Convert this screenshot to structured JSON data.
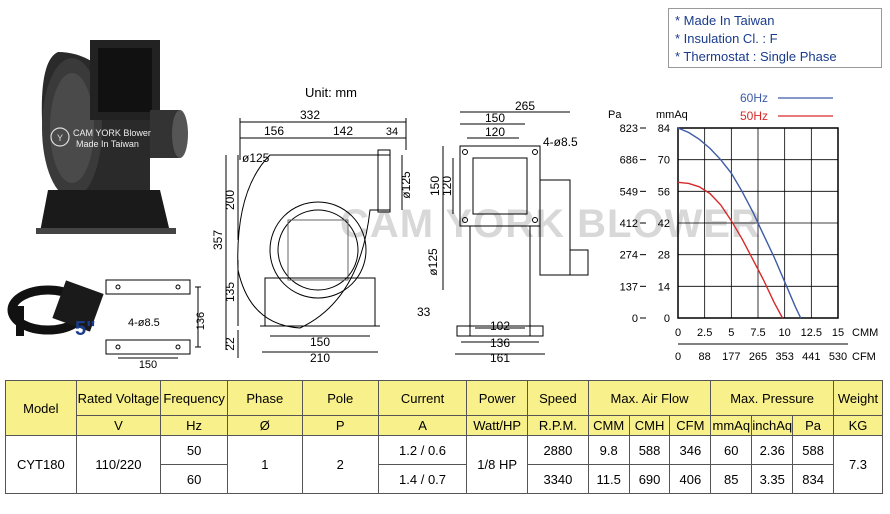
{
  "notes": [
    "* Made In Taiwan",
    "* Insulation Cl. : F",
    "* Thermostat : Single Phase"
  ],
  "unit_label": "Unit: mm",
  "watermark": "CAM YORK BLOWER",
  "photo": {
    "brand_line1": "CAM YORK Blower",
    "brand_line2": "Made In Taiwan"
  },
  "flange": {
    "size_label": "5\"",
    "hole_label": "4-ø8.5",
    "dim_w": "150",
    "dim_h": "136"
  },
  "side_view": {
    "d_332": "332",
    "d_156": "156",
    "d_142": "142",
    "d_34": "34",
    "d_125_top": "ø125",
    "d_125_side": "ø125",
    "d_200": "200",
    "d_357": "357",
    "d_135": "135",
    "d_22": "22",
    "d_150": "150",
    "d_210": "210"
  },
  "front_view": {
    "d_265": "265",
    "d_150": "150",
    "d_120": "120",
    "holes": "4-ø8.5",
    "d_150v": "150",
    "d_120v": "120",
    "d_125": "ø125",
    "d_33": "33",
    "d_102": "102",
    "d_136": "136",
    "d_161": "161"
  },
  "colors": {
    "hz60": "#3d5ba8",
    "hz50": "#d62a2a",
    "header_bg": "#f8f08a",
    "note_text": "#1a3c8c"
  },
  "chart_data": {
    "type": "line",
    "legend_placement": "top-right",
    "y_unit_left": "Pa",
    "y_unit_right": "mmAq",
    "y_ticks_pa": [
      "823",
      "686",
      "549",
      "412",
      "274",
      "137",
      "0"
    ],
    "y_ticks_mmaq": [
      "84",
      "70",
      "56",
      "42",
      "28",
      "14",
      "0"
    ],
    "x_unit_cmm": "CMM",
    "x_unit_cfm": "CFM",
    "x_ticks_cmm": [
      "0",
      "2.5",
      "5",
      "7.5",
      "10",
      "12.5",
      "15"
    ],
    "x_ticks_cfm": [
      "0",
      "88",
      "177",
      "265",
      "353",
      "441",
      "530"
    ],
    "xlim": [
      0,
      15
    ],
    "ylim": [
      0,
      84
    ],
    "grid": true,
    "series": [
      {
        "name": "60Hz",
        "color": "#3d5ba8",
        "x": [
          0,
          1,
          2,
          3,
          4,
          5,
          6,
          7,
          8,
          9,
          10,
          11,
          11.5
        ],
        "y": [
          84,
          82,
          79,
          75,
          70,
          64,
          56,
          47,
          37,
          27,
          16,
          5,
          0
        ]
      },
      {
        "name": "50Hz",
        "color": "#d62a2a",
        "x": [
          0,
          1,
          2,
          3,
          4,
          5,
          6,
          7,
          8,
          9,
          9.8
        ],
        "y": [
          60,
          59.5,
          58,
          55,
          50,
          43,
          35,
          26,
          17,
          7,
          0
        ]
      }
    ]
  },
  "table": {
    "headers": {
      "model": "Model",
      "voltage": "Rated Voltage",
      "frequency": "Frequency",
      "phase": "Phase",
      "pole": "Pole",
      "current": "Current",
      "power": "Power",
      "speed": "Speed",
      "airflow": "Max. Air Flow",
      "pressure": "Max. Pressure",
      "weight": "Weight"
    },
    "units": {
      "voltage": "V",
      "frequency": "Hz",
      "phase": "Ø",
      "pole": "P",
      "current": "A",
      "power": "Watt/HP",
      "speed": "R.P.M.",
      "cmm": "CMM",
      "cmh": "CMH",
      "cfm": "CFM",
      "mmaq": "mmAq",
      "inchaq": "inchAq",
      "pa": "Pa",
      "weight": "KG"
    },
    "model": "CYT180",
    "voltage": "110/220",
    "phase": "1",
    "pole": "2",
    "power": "1/8 HP",
    "weight": "7.3",
    "rows": [
      {
        "frequency": "50",
        "current": "1.2 / 0.6",
        "speed": "2880",
        "cmm": "9.8",
        "cmh": "588",
        "cfm": "346",
        "mmaq": "60",
        "inchaq": "2.36",
        "pa": "588"
      },
      {
        "frequency": "60",
        "current": "1.4 / 0.7",
        "speed": "3340",
        "cmm": "11.5",
        "cmh": "690",
        "cfm": "406",
        "mmaq": "85",
        "inchaq": "3.35",
        "pa": "834"
      }
    ]
  }
}
